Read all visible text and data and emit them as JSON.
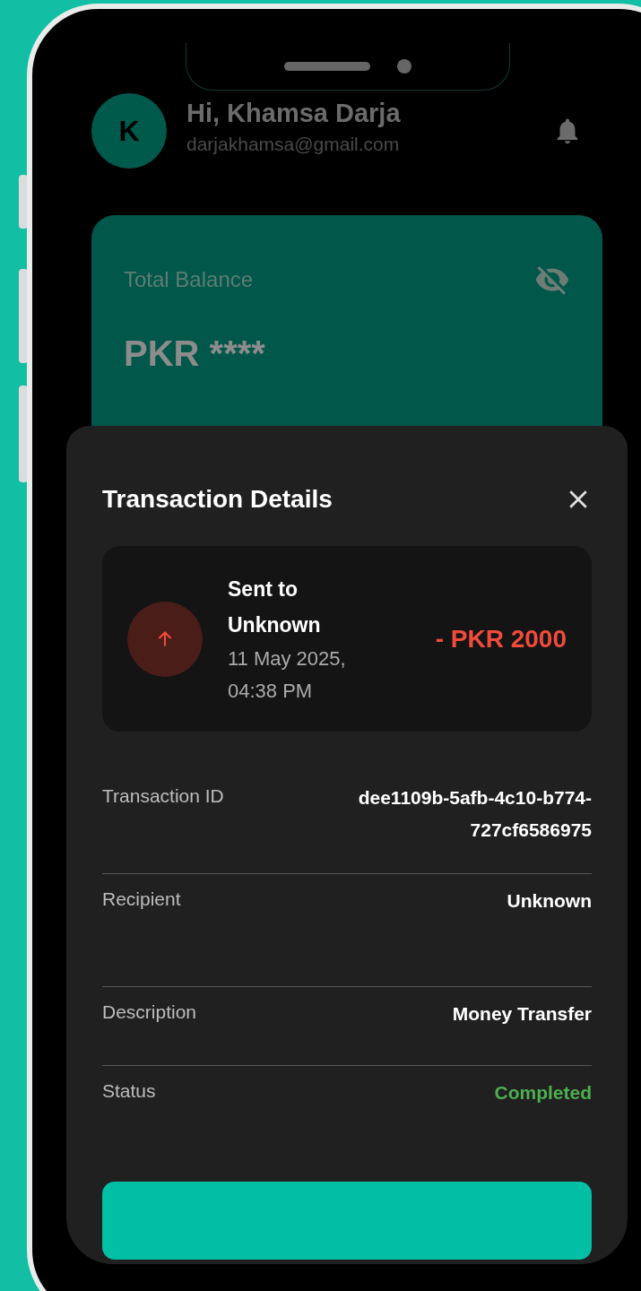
{
  "header": {
    "avatar_initial": "K",
    "greeting": "Hi, Khamsa Darja",
    "email": "darjakhamsa@gmail.com"
  },
  "balance_card": {
    "label": "Total Balance",
    "amount": "PKR ****"
  },
  "sheet": {
    "title": "Transaction Details",
    "summary": {
      "title": "Sent to Unknown",
      "date": "11 May 2025, 04:38 PM",
      "amount": "- PKR 2000"
    },
    "rows": [
      {
        "kind": "text",
        "label": "Transaction ID",
        "value": "dee1109b-5afb-4c10-b774-727cf6586975"
      },
      {
        "kind": "text",
        "label": "Recipient",
        "value": "Unknown"
      },
      {
        "kind": "text",
        "label": "Description",
        "value": "Money Transfer"
      },
      {
        "kind": "status",
        "label": "Status",
        "value": "Completed",
        "color": "#4caf50"
      }
    ]
  }
}
